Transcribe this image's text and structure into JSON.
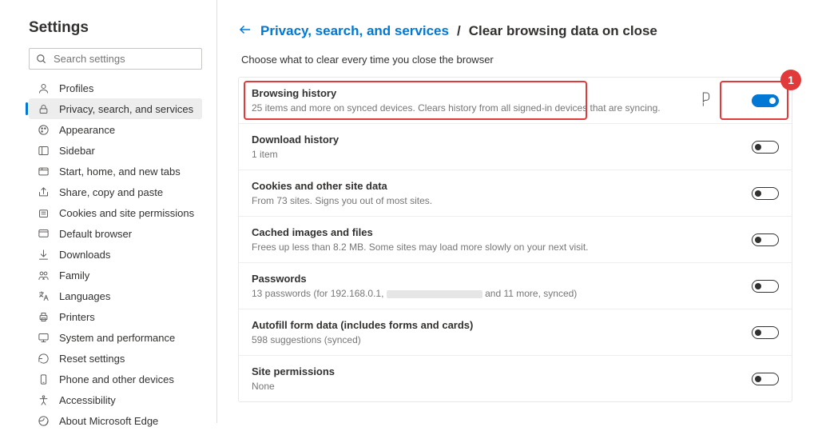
{
  "sidebar": {
    "title": "Settings",
    "search_placeholder": "Search settings",
    "items": [
      {
        "icon": "profile",
        "label": "Profiles"
      },
      {
        "icon": "lock",
        "label": "Privacy, search, and services"
      },
      {
        "icon": "appearance",
        "label": "Appearance"
      },
      {
        "icon": "sidebar",
        "label": "Sidebar"
      },
      {
        "icon": "tabs",
        "label": "Start, home, and new tabs"
      },
      {
        "icon": "share",
        "label": "Share, copy and paste"
      },
      {
        "icon": "cookies",
        "label": "Cookies and site permissions"
      },
      {
        "icon": "browser",
        "label": "Default browser"
      },
      {
        "icon": "download",
        "label": "Downloads"
      },
      {
        "icon": "family",
        "label": "Family"
      },
      {
        "icon": "lang",
        "label": "Languages"
      },
      {
        "icon": "printer",
        "label": "Printers"
      },
      {
        "icon": "perf",
        "label": "System and performance"
      },
      {
        "icon": "reset",
        "label": "Reset settings"
      },
      {
        "icon": "phone",
        "label": "Phone and other devices"
      },
      {
        "icon": "access",
        "label": "Accessibility"
      },
      {
        "icon": "edge",
        "label": "About Microsoft Edge"
      }
    ],
    "active_index": 1
  },
  "header": {
    "breadcrumb_link": "Privacy, search, and services",
    "breadcrumb_current": "Clear browsing data on close",
    "subtitle": "Choose what to clear every time you close the browser"
  },
  "rows": [
    {
      "title": "Browsing history",
      "desc": "25 items and more on synced devices. Clears history from all signed-in devices that are syncing.",
      "on": true,
      "annot": true,
      "badge": "1",
      "cursor": true
    },
    {
      "title": "Download history",
      "desc": "1 item",
      "on": false
    },
    {
      "title": "Cookies and other site data",
      "desc": "From 73 sites. Signs you out of most sites.",
      "on": false
    },
    {
      "title": "Cached images and files",
      "desc": "Frees up less than 8.2 MB. Some sites may load more slowly on your next visit.",
      "on": false
    },
    {
      "title": "Passwords",
      "desc_pre": "13 passwords (for 192.168.0.1, ",
      "desc_post": " and 11 more, synced)",
      "blur": true,
      "on": false
    },
    {
      "title": "Autofill form data (includes forms and cards)",
      "desc": "598 suggestions (synced)",
      "on": false
    },
    {
      "title": "Site permissions",
      "desc": "None",
      "on": false
    }
  ]
}
